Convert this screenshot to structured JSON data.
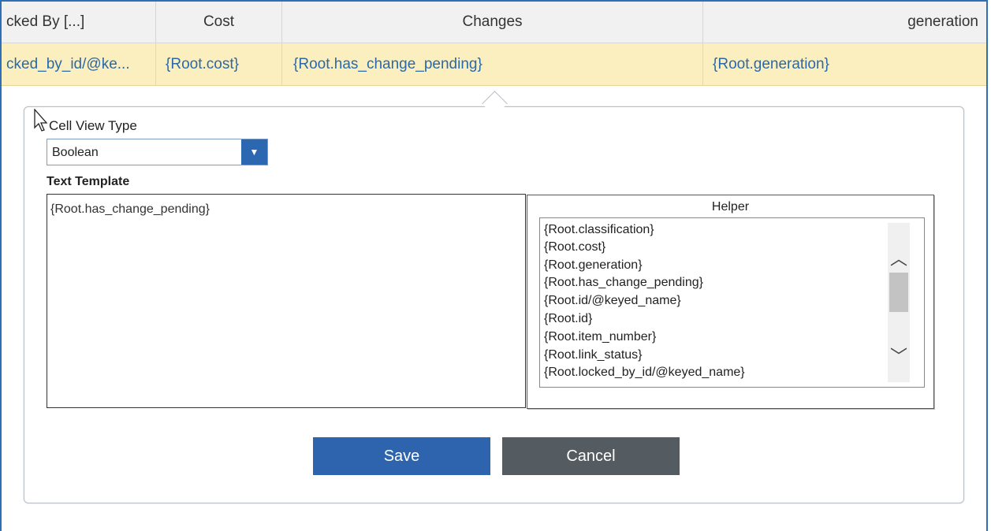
{
  "grid": {
    "headers": [
      "cked By [...]",
      "Cost",
      "Changes",
      "generation"
    ],
    "row": [
      "cked_by_id/@ke...",
      "{Root.cost}",
      "{Root.has_change_pending}",
      "{Root.generation}"
    ]
  },
  "dialog": {
    "cell_view_type_label": "Cell View Type",
    "cell_view_type_value": "Boolean",
    "text_template_label": "Text Template",
    "text_template_value": "{Root.has_change_pending}",
    "helper_title": "Helper",
    "helper_items": [
      "{Root.classification}",
      "{Root.cost}",
      "{Root.generation}",
      "{Root.has_change_pending}",
      "{Root.id/@keyed_name}",
      "{Root.id}",
      "{Root.item_number}",
      "{Root.link_status}",
      "{Root.locked_by_id/@keyed_name}"
    ],
    "save_label": "Save",
    "cancel_label": "Cancel"
  },
  "colors": {
    "accent": "#2d64ad",
    "row_highlight": "#fcefbf",
    "link_text": "#2a69a9",
    "cancel_bg": "#555c61"
  }
}
